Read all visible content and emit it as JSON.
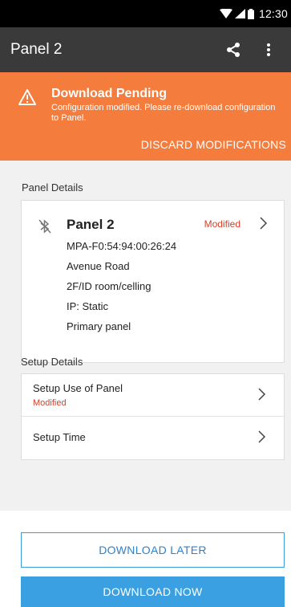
{
  "status_bar": {
    "time": "12:30",
    "icons": [
      "wifi-icon",
      "cell-signal-icon",
      "battery-icon"
    ]
  },
  "app_bar": {
    "title": "Panel 2",
    "icons": [
      "share-icon",
      "more-vert-icon"
    ]
  },
  "banner": {
    "title": "Download Pending",
    "message": "Configuration modified. Please re-download configuration to Panel.",
    "discard_label": "DISCARD MODIFICATIONS",
    "color": "#f47c3c"
  },
  "panel_details": {
    "section_label": "Panel Details",
    "name": "Panel 2",
    "badge": "Modified",
    "lines": [
      "MPA-F0:54:94:00:26:24",
      "Avenue Road",
      "2F/ID room/celling",
      "IP: Static",
      "Primary panel"
    ]
  },
  "setup_details": {
    "section_label": "Setup Details",
    "rows": [
      {
        "label": "Setup Use of Panel",
        "sub": "Modified"
      },
      {
        "label": "Setup Time"
      }
    ]
  },
  "actions": {
    "later_label": "DOWNLOAD LATER",
    "now_label": "DOWNLOAD NOW",
    "accent": "#3ba0e2"
  }
}
